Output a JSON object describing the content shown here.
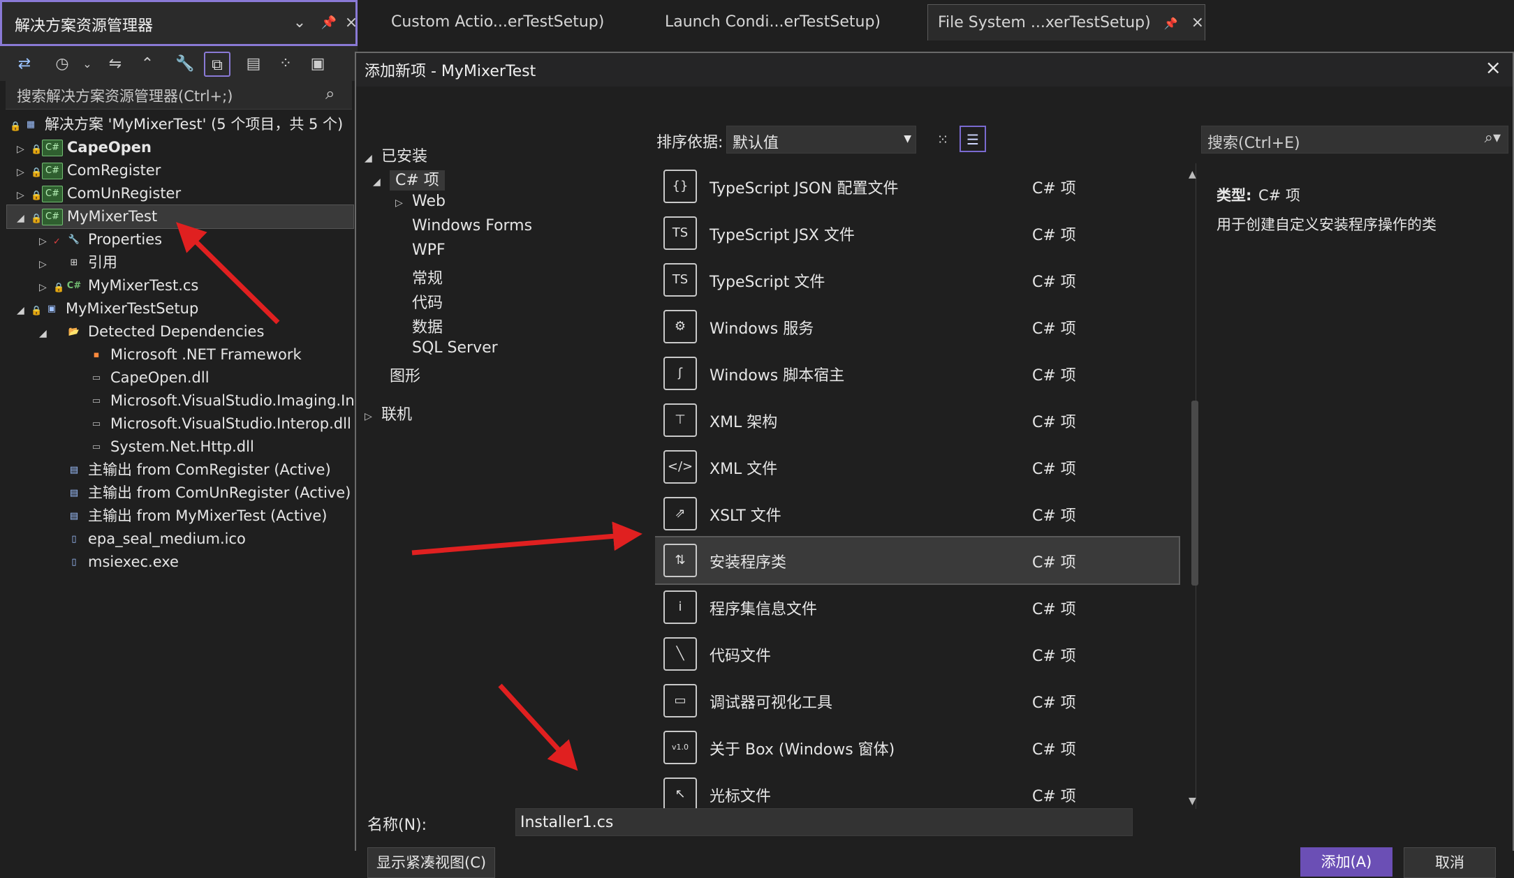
{
  "solution_explorer": {
    "title": "解决方案资源管理器",
    "search_placeholder": "搜索解决方案资源管理器(Ctrl+;)",
    "tree": [
      {
        "label": "解决方案 'MyMixerTest' (5 个项目，共 5 个)"
      },
      {
        "label": "CapeOpen"
      },
      {
        "label": "ComRegister"
      },
      {
        "label": "ComUnRegister"
      },
      {
        "label": "MyMixerTest"
      },
      {
        "label": "Properties"
      },
      {
        "label": "引用"
      },
      {
        "label": "MyMixerTest.cs"
      },
      {
        "label": "MyMixerTestSetup"
      },
      {
        "label": "Detected Dependencies"
      },
      {
        "label": "Microsoft .NET Framework"
      },
      {
        "label": "CapeOpen.dll"
      },
      {
        "label": "Microsoft.VisualStudio.Imaging.Int"
      },
      {
        "label": "Microsoft.VisualStudio.Interop.dll"
      },
      {
        "label": "System.Net.Http.dll"
      },
      {
        "label": "主输出 from ComRegister (Active)"
      },
      {
        "label": "主输出 from ComUnRegister (Active)"
      },
      {
        "label": "主输出 from MyMixerTest (Active)"
      },
      {
        "label": "epa_seal_medium.ico"
      },
      {
        "label": "msiexec.exe"
      }
    ]
  },
  "tabs": [
    {
      "label": "Custom Actio...erTestSetup)"
    },
    {
      "label": "Launch Condi...erTestSetup)"
    },
    {
      "label": "File System ...xerTestSetup)"
    }
  ],
  "dialog": {
    "title": "添加新项 - MyMixerTest",
    "installed_label": "已安装",
    "categories": [
      "C# 项",
      "Web",
      "Windows Forms",
      "WPF",
      "常规",
      "代码",
      "数据",
      "SQL Server",
      "图形"
    ],
    "online_label": "联机",
    "sort_label": "排序依据:",
    "sort_value": "默认值",
    "search_placeholder": "搜索(Ctrl+E)",
    "items": [
      {
        "name": "TypeScript JSON 配置文件",
        "type": "C# 项"
      },
      {
        "name": "TypeScript JSX 文件",
        "type": "C# 项"
      },
      {
        "name": "TypeScript 文件",
        "type": "C# 项"
      },
      {
        "name": "Windows 服务",
        "type": "C# 项"
      },
      {
        "name": "Windows 脚本宿主",
        "type": "C# 项"
      },
      {
        "name": "XML 架构",
        "type": "C# 项"
      },
      {
        "name": "XML 文件",
        "type": "C# 项"
      },
      {
        "name": "XSLT 文件",
        "type": "C# 项"
      },
      {
        "name": "安装程序类",
        "type": "C# 项"
      },
      {
        "name": "程序集信息文件",
        "type": "C# 项"
      },
      {
        "name": "代码文件",
        "type": "C# 项"
      },
      {
        "name": "调试器可视化工具",
        "type": "C# 项"
      },
      {
        "name": "关于 Box (Windows 窗体)",
        "type": "C# 项"
      },
      {
        "name": "光标文件",
        "type": "C# 项"
      }
    ],
    "info_type_label": "类型:",
    "info_type_value": "C# 项",
    "info_description": "用于创建自定义安装程序操作的类",
    "name_label": "名称(N):",
    "name_value": "Installer1.cs",
    "compact_view_label": "显示紧凑视图(C)",
    "add_label": "添加(A)",
    "cancel_label": "取消"
  },
  "colors": {
    "accent": "#6b4fb5",
    "annotation_arrow": "#e02020"
  }
}
